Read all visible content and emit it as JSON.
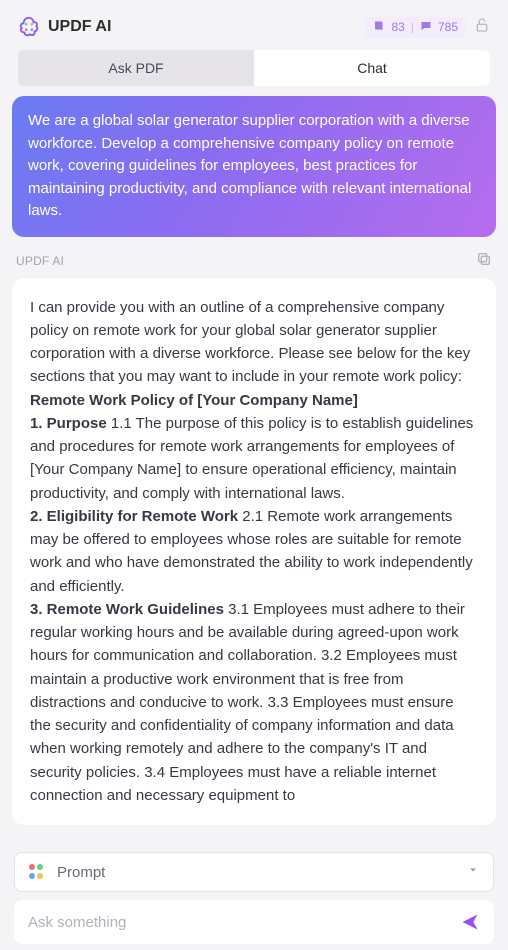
{
  "header": {
    "title": "UPDF AI",
    "count1": "83",
    "count2": "785"
  },
  "tabs": {
    "ask_pdf": "Ask PDF",
    "chat": "Chat"
  },
  "user_message": "We are a global solar generator supplier corporation with a diverse workforce. Develop a comprehensive company policy on remote work, covering guidelines for employees, best practices for maintaining productivity, and compliance with relevant international laws.",
  "ai_label": "UPDF AI",
  "ai_response": {
    "intro": "I can provide you with an outline of a comprehensive company policy on remote work for your global solar generator supplier corporation with a diverse workforce. Please see below for the key sections that you may want to include in your remote work policy:",
    "title": "Remote Work Policy of [Your Company Name]",
    "s1_head": "1. Purpose",
    "s1_body": " 1.1 The purpose of this policy is to establish guidelines and procedures for remote work arrangements for employees of [Your Company Name] to ensure operational efficiency, maintain productivity, and comply with international laws.",
    "s2_head": "2. Eligibility for Remote Work",
    "s2_body": " 2.1 Remote work arrangements may be offered to employees whose roles are suitable for remote work and who have demonstrated the ability to work independently and efficiently.",
    "s3_head": "3. Remote Work Guidelines",
    "s3_body": " 3.1 Employees must adhere to their regular working hours and be available during agreed-upon work hours for communication and collaboration. 3.2 Employees must maintain a productive work environment that is free from distractions and conducive to work. 3.3 Employees must ensure the security and confidentiality of company information and data when working remotely and adhere to the company's IT and security policies. 3.4 Employees must have a reliable internet connection and necessary equipment to"
  },
  "prompt": {
    "label": "Prompt",
    "placeholder": "Ask something"
  }
}
